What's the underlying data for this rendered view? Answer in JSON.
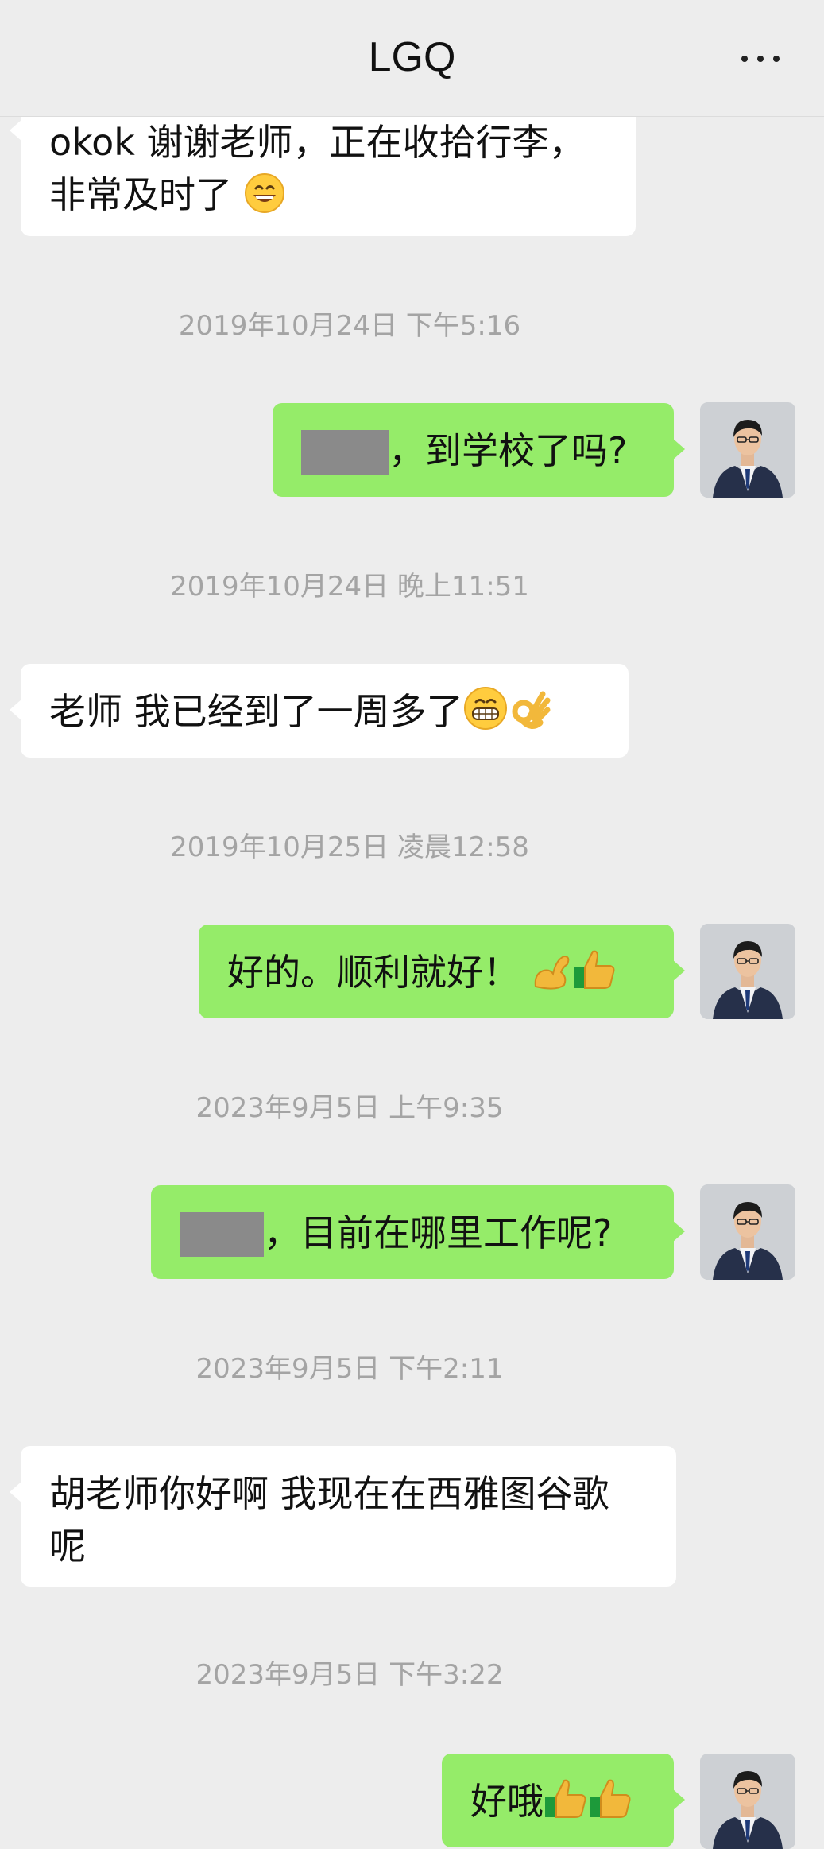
{
  "header": {
    "title": "LGQ"
  },
  "messages": {
    "m1": {
      "line1": "okok 谢谢老师，正在收拾行李，",
      "line2": "非常及时了"
    },
    "ts1": "2019年10月24日 下午5:16",
    "m2": {
      "text": "，到学校了吗?"
    },
    "ts2": "2019年10月24日 晚上11:51",
    "m3": {
      "text": "老师 我已经到了一周多了"
    },
    "ts3": "2019年10月25日 凌晨12:58",
    "m4": {
      "text": "好的。顺利就好！"
    },
    "ts4": "2023年9月5日 上午9:35",
    "m5": {
      "text": "，目前在哪里工作呢?"
    },
    "ts5": "2023年9月5日 下午2:11",
    "m6": {
      "line1": "胡老师你好啊 我现在在西雅图谷歌",
      "line2": "呢"
    },
    "ts6": "2023年9月5日 下午3:22",
    "m7": {
      "text": "好哦"
    }
  },
  "icons": {
    "more": "more-dots-icon",
    "grin": "grinning-emoji-icon",
    "grimace": "grimacing-emoji-icon",
    "ok_hand": "ok-hand-emoji-icon",
    "muscle": "flexed-biceps-emoji-icon",
    "thumbs_up": "thumbs-up-emoji-icon",
    "avatar": "avatar-man-in-suit"
  },
  "colors": {
    "background": "#ededed",
    "incoming_bubble": "#ffffff",
    "outgoing_bubble": "#95ec69",
    "timestamp": "#a4a4a4",
    "redaction": "#8a8a8a"
  }
}
